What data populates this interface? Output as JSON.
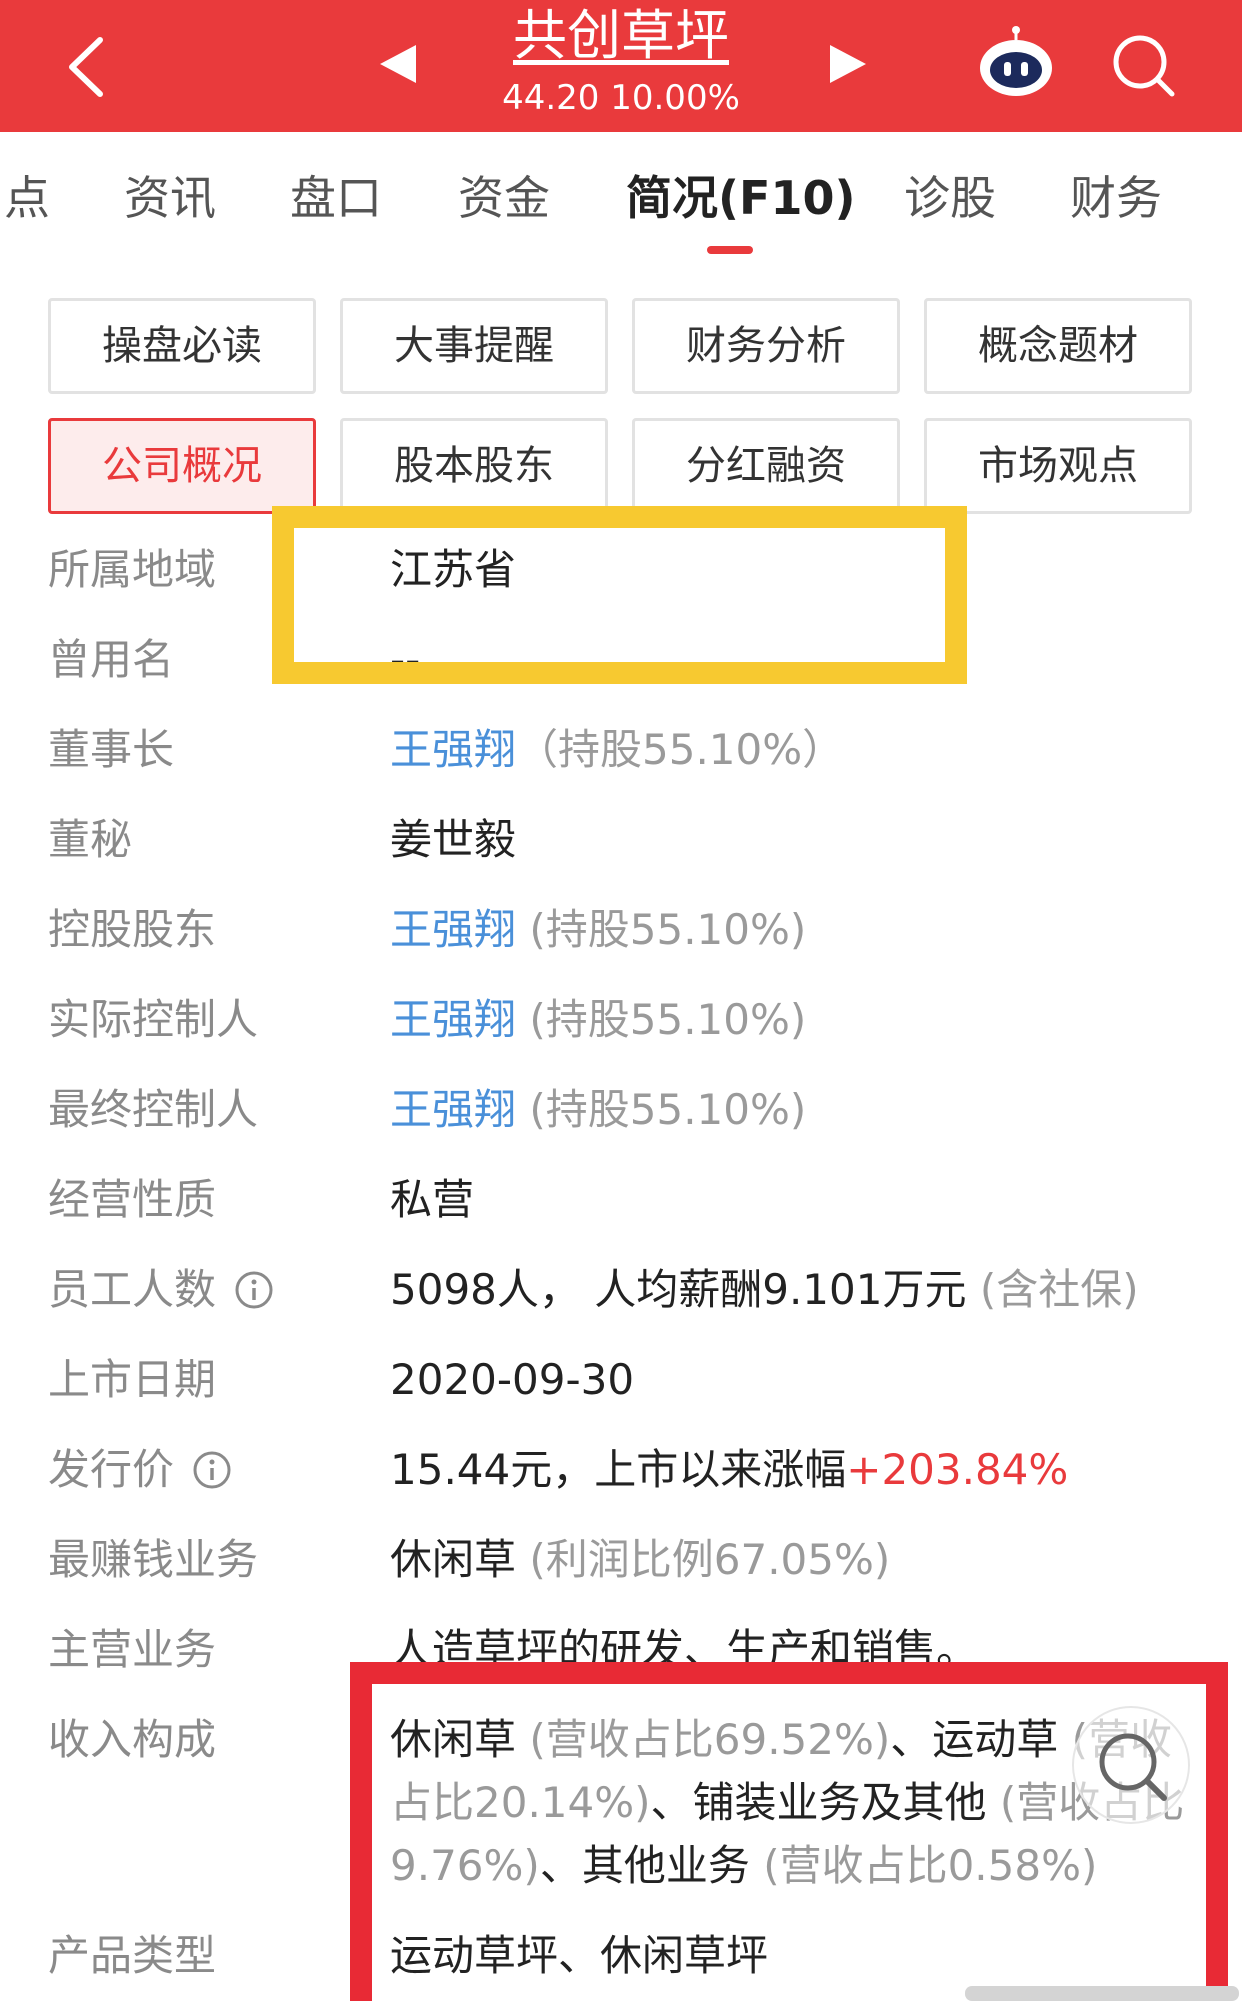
{
  "header": {
    "stock_name": "共创草坪",
    "price_line": "44.20  10.00%",
    "colors": {
      "brand": "#e93a3c"
    }
  },
  "tabs": [
    {
      "label": "点"
    },
    {
      "label": "资讯"
    },
    {
      "label": "盘口"
    },
    {
      "label": "资金"
    },
    {
      "label": "简况(F10)",
      "active": true
    },
    {
      "label": "诊股"
    },
    {
      "label": "财务"
    }
  ],
  "sections": [
    {
      "label": "操盘必读"
    },
    {
      "label": "大事提醒"
    },
    {
      "label": "财务分析"
    },
    {
      "label": "概念题材"
    },
    {
      "label": "公司概况",
      "active": true
    },
    {
      "label": "股本股东"
    },
    {
      "label": "分红融资"
    },
    {
      "label": "市场观点"
    }
  ],
  "info": {
    "region": {
      "label": "所属地域",
      "value": "江苏省"
    },
    "former_name": {
      "label": "曾用名",
      "value": "--"
    },
    "chairman": {
      "label": "董事长",
      "name": "王强翔",
      "note": "（持股55.10%）"
    },
    "secretary": {
      "label": "董秘",
      "value": "姜世毅"
    },
    "controlling_shareholder": {
      "label": "控股股东",
      "name": "王强翔",
      "note": "(持股55.10%)"
    },
    "actual_controller": {
      "label": "实际控制人",
      "name": "王强翔",
      "note": "(持股55.10%)"
    },
    "ultimate_controller": {
      "label": "最终控制人",
      "name": "王强翔",
      "note": "(持股55.10%)"
    },
    "ownership": {
      "label": "经营性质",
      "value": "私营"
    },
    "employees": {
      "label": "员工人数",
      "value": "5098人， 人均薪酬9.101万元",
      "note": "(含社保)"
    },
    "listing_date": {
      "label": "上市日期",
      "value": "2020-09-30"
    },
    "issue_price": {
      "label": "发行价",
      "value": "15.44元，上市以来涨幅",
      "gain": "+203.84%"
    },
    "top_business": {
      "label": "最赚钱业务",
      "value": "休闲草",
      "note": "(利润比例67.05%)"
    },
    "main_business": {
      "label": "主营业务",
      "value": "人造草坪的研发、生产和销售。"
    },
    "revenue": {
      "label": "收入构成",
      "line1_a": "休闲草",
      "line1_b": "(营收占比69.52%)",
      "line1_c": "、运动草",
      "line1_d": "(营收",
      "line2_a": "占比20.14%)",
      "line2_b": "、铺装业务及其他",
      "line2_c": "(营收占比",
      "line3_a": "9.76%)",
      "line3_b": "、其他业务",
      "line3_c": "(营收占比0.58%)"
    },
    "product_type": {
      "label": "产品类型",
      "value": "运动草坪、休闲草坪"
    }
  }
}
